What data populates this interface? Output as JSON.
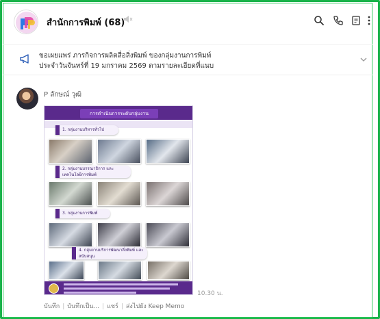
{
  "header": {
    "title": "สำนักการพิมพ์ (68)",
    "mute_icon": "speaker-muted-icon",
    "icons": [
      "search-icon",
      "phone-icon",
      "notes-icon",
      "more-vertical-icon"
    ]
  },
  "banner": {
    "icon": "megaphone-icon",
    "line1": "ขอเผยแพร่ ภารกิจการผลิตสื่อสิ่งพิมพ์ ของกลุ่มงานการพิมพ์",
    "line2": "ประจำวันจันทร์ที่ 19 มกราคม 2569 ตามรายละเอียดที่แนบ"
  },
  "message": {
    "sender": "P ลักษณ์ วุฒิ",
    "time": "10.30 น.",
    "poster": {
      "title": "การดำเนินการระดับกลุ่มงาน",
      "sections": [
        "1. กลุ่มงานบริหารทั่วไป",
        "2. กลุ่มงานบรรณาธิการ และเทคโนโลยีการพิมพ์",
        "3. กลุ่มงานการพิมพ์",
        "4. กลุ่มงานบริการพัฒนาสิ่งพิมพ์ และสนับสนุน"
      ]
    },
    "actions": [
      "บันทึก",
      "บันทึกเป็น...",
      "แชร์",
      "ส่งไปยัง Keep Memo"
    ]
  },
  "colors": {
    "frame": "#19b34a",
    "poster_purple": "#5a2a8c"
  }
}
